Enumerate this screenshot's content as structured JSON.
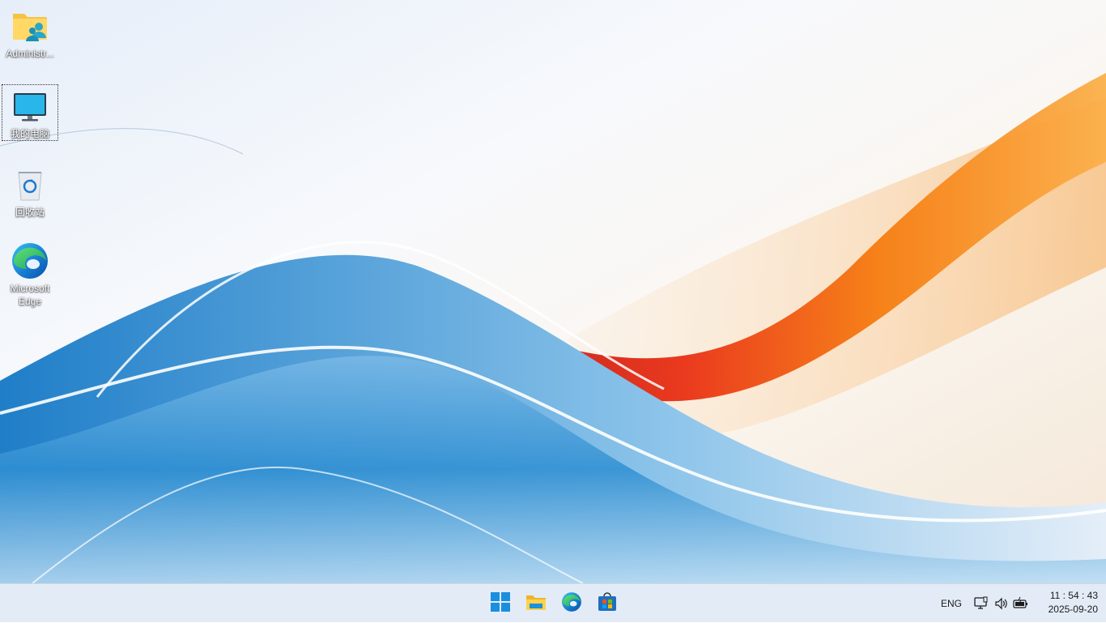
{
  "desktop": {
    "icons": [
      {
        "label": "Administr...",
        "icon": "user-folder-icon"
      },
      {
        "label": "我的电脑",
        "icon": "monitor-icon"
      },
      {
        "label": "回收站",
        "icon": "recycle-bin-icon"
      },
      {
        "label": "Microsoft Edge",
        "icon": "edge-icon"
      }
    ]
  },
  "taskbar": {
    "pinned": [
      {
        "icon": "windows-start-icon"
      },
      {
        "icon": "file-explorer-icon"
      },
      {
        "icon": "edge-icon"
      },
      {
        "icon": "microsoft-store-icon"
      }
    ],
    "tray": {
      "language": "ENG",
      "icons": [
        "network-icon",
        "volume-icon",
        "battery-icon"
      ]
    },
    "clock": {
      "time": "11 : 54 : 43",
      "date": "2025-09-20"
    }
  },
  "colors": {
    "wallpaper_blue": "#2a8fd0",
    "wallpaper_orange": "#f48a1a",
    "wallpaper_red": "#d8261a",
    "taskbar_bg": "#e3ecf6"
  }
}
